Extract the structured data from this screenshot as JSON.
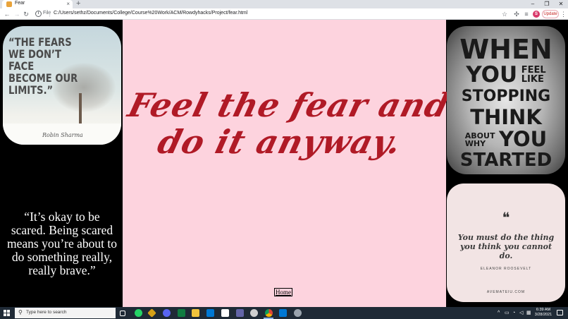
{
  "browser": {
    "tab_title": "Fear",
    "tab_close": "×",
    "new_tab": "+",
    "window_controls": {
      "minimize": "–",
      "restore": "❐",
      "close": "✕"
    },
    "nav": {
      "back": "←",
      "forward": "→",
      "reload": "↻"
    },
    "omnibox": {
      "info": "i",
      "scheme_label": "File",
      "url": "C:/Users/sethz/Documents/College/Course%20Work/ACM/Rowdyhacks/Project/fear.html"
    },
    "bookmark_icon": "☆",
    "extensions_icon": "✣",
    "media_icon": "≡",
    "profile_initial": "S",
    "update_label": "Update",
    "menu_icon": "⋮"
  },
  "page": {
    "headline": "Feel the fear and do it anyway.",
    "home_link": "Home",
    "left_image": {
      "quote_open": "“",
      "quote_text": "THE FEARS WE DON’T FACE BECOME OUR LIMITS.”",
      "author": "Robin Sharma"
    },
    "left_quote": "“It’s okay to be scared. Being scared means you’re about to do something really, really brave.”",
    "right_top_image": {
      "line1": "WHEN",
      "line2a": "YOU",
      "line2b_top": "FEEL",
      "line2b_bottom": "LIKE",
      "line3": "STOPPING",
      "line4": "THINK",
      "line5a_top": "ABOUT",
      "line5a_bottom": "WHY",
      "line5b": "YOU",
      "line6": "STARTED"
    },
    "right_bottom_image": {
      "quote_marks": "❝",
      "quote_text": "You must do the thing you think you cannot do.",
      "author": "ELEANOR ROOSEVELT",
      "site": "AVEMATEIU.COM"
    }
  },
  "taskbar": {
    "search_placeholder": "Type here to search",
    "search_icon": "⚲",
    "tray_chevron": "^",
    "clock_time": "6:39 AM",
    "clock_date": "3/28/2021"
  },
  "colors": {
    "page_background": "#fdd3de",
    "headline": "#b01a26",
    "side_background": "#000000",
    "taskbar": "#1f2a36",
    "update_text": "#c5221f"
  }
}
